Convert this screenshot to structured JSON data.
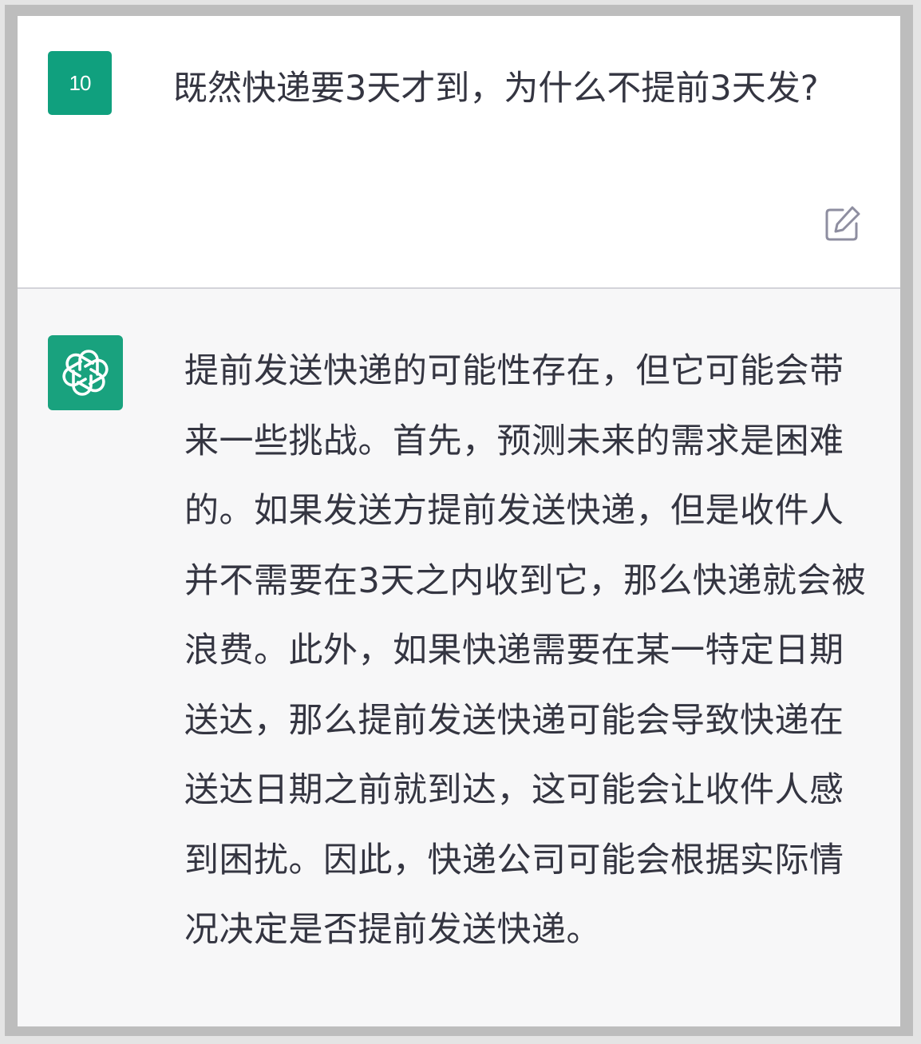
{
  "conversation": {
    "user_message": {
      "avatar_label": "10",
      "text": "既然快递要3天才到，为什么不提前3天发?"
    },
    "assistant_message": {
      "avatar_icon": "openai-logo-icon",
      "text": "提前发送快递的可能性存在，但它可能会带来一些挑战。首先，预测未来的需求是困难的。如果发送方提前发送快递，但是收件人并不需要在3天之内收到它，那么快递就会被浪费。此外，如果快递需要在某一特定日期送达，那么提前发送快递可能会导致快递在送达日期之前就到达，这可能会让收件人感到困扰。因此，快递公司可能会根据实际情况决定是否提前发送快递。"
    },
    "edit_icon": "edit-icon"
  },
  "colors": {
    "user_avatar_bg": "#10a07e",
    "assistant_avatar_bg": "#19a27e",
    "user_bg": "#ffffff",
    "assistant_bg": "#f7f7f8",
    "text": "#343541"
  }
}
